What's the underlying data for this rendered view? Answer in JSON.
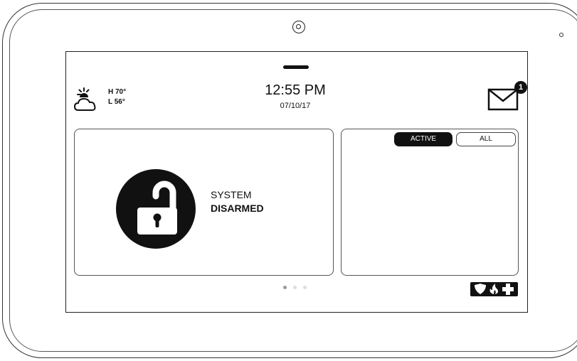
{
  "header": {
    "weather": {
      "icon": "partly-cloudy-icon",
      "high": "H 70°",
      "low": "L 56°"
    },
    "time": "12:55 PM",
    "date": "07/10/17",
    "messages": {
      "icon": "envelope-icon",
      "badge_count": "1"
    }
  },
  "status_panel": {
    "icon": "unlocked-padlock-icon",
    "line1": "SYSTEM",
    "line2": "DISARMED"
  },
  "events_panel": {
    "tabs": [
      {
        "label": "ACTIVE",
        "selected": true
      },
      {
        "label": "ALL",
        "selected": false
      }
    ]
  },
  "pager": {
    "total": 3,
    "current": 1
  },
  "emergency_button": {
    "icons": [
      "shield-icon",
      "fire-icon",
      "medical-cross-icon"
    ]
  },
  "colors": {
    "primary": "#111111",
    "background": "#ffffff",
    "dot_active": "#9a9a9a",
    "dot_inactive": "#dddddd"
  }
}
